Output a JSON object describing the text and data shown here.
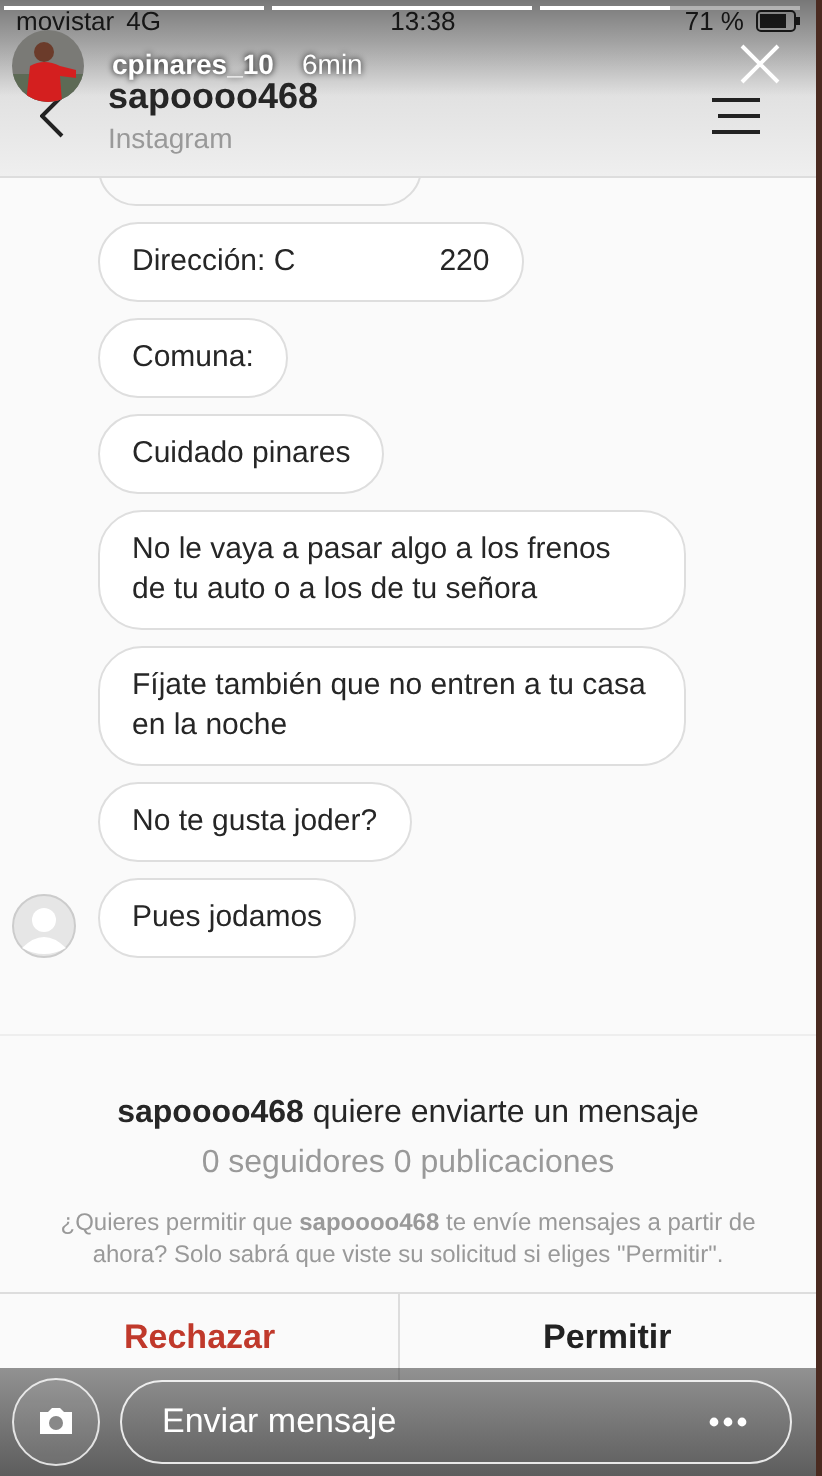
{
  "status_bar": {
    "carrier": "movistar",
    "network": "4G",
    "time": "13:38",
    "battery": "71 %"
  },
  "story": {
    "segments": [
      {
        "level": 1
      },
      {
        "level": 1
      },
      {
        "level": 0.5
      }
    ],
    "username": "cpinares_10",
    "age": "6min"
  },
  "header": {
    "title": "sapoooo468",
    "subtitle": "Instagram"
  },
  "messages": [
    {
      "kind": "cut"
    },
    {
      "kind": "bubble",
      "parts": [
        "Dirección:  C",
        "220"
      ]
    },
    {
      "kind": "bubble",
      "parts": [
        "Comuna:"
      ]
    },
    {
      "kind": "bubble",
      "parts": [
        "Cuidado pinares"
      ]
    },
    {
      "kind": "bubble",
      "parts": [
        "No le vaya a pasar algo a los frenos de tu auto o a los de tu señora"
      ]
    },
    {
      "kind": "bubble",
      "parts": [
        "Fíjate también que no entren a tu casa en la noche"
      ]
    },
    {
      "kind": "bubble",
      "parts": [
        "No te gusta joder?"
      ]
    },
    {
      "kind": "bubble",
      "parts": [
        "Pues jodamos"
      ],
      "avatar": true
    }
  ],
  "request": {
    "title": "**sapoooo468** quiere enviarte un mensaje",
    "stats": "0 seguidores  0 publicaciones",
    "note": "¿Quieres permitir que **sapoooo468** te envíe mensajes a partir de ahora? Solo sabrá que viste su solicitud si eliges \"Permitir\".",
    "decline": "Rechazar",
    "accept": "Permitir"
  },
  "reply": {
    "placeholder": "Enviar mensaje"
  }
}
